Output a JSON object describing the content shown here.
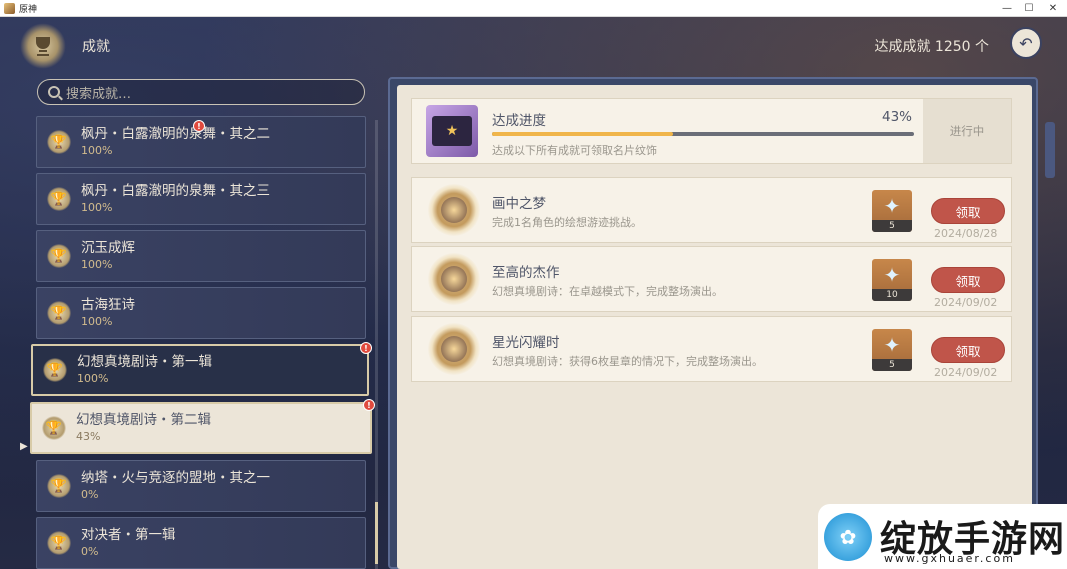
{
  "window": {
    "title": "原神",
    "minimize": "—",
    "maximize": "☐",
    "close": "✕"
  },
  "header": {
    "title": "成就",
    "achieved_label": "达成成就 1250 个",
    "back_icon": "↶"
  },
  "search": {
    "placeholder": "搜索成就…"
  },
  "categories": [
    {
      "name": "枫丹・白露澈明的泉舞・其之二",
      "percent": "100%",
      "badge": "!"
    },
    {
      "name": "枫丹・白露澈明的泉舞・其之三",
      "percent": "100%"
    },
    {
      "name": "沉玉成辉",
      "percent": "100%"
    },
    {
      "name": "古海狂诗",
      "percent": "100%"
    },
    {
      "name": "幻想真境剧诗・第一辑",
      "percent": "100%",
      "badge": "!"
    },
    {
      "name": "幻想真境剧诗・第二辑",
      "percent": "43%",
      "badge": "!"
    },
    {
      "name": "纳塔・火与竞逐的盟地・其之一",
      "percent": "0%"
    },
    {
      "name": "对决者・第一辑",
      "percent": "0%"
    }
  ],
  "progress": {
    "title": "达成进度",
    "percent_label": "43%",
    "percent_value": 0.43,
    "description": "达成以下所有成就可领取名片纹饰",
    "status": "进行中"
  },
  "achievements": [
    {
      "title": "画中之梦",
      "description": "完成1名角色的绘想游迹挑战。",
      "reward_count": "5",
      "button": "领取",
      "date": "2024/08/28"
    },
    {
      "title": "至高的杰作",
      "description": "幻想真境剧诗：在卓越模式下，完成整场演出。",
      "reward_count": "10",
      "button": "领取",
      "date": "2024/09/02"
    },
    {
      "title": "星光闪耀时",
      "description": "幻想真境剧诗：获得6枚星章的情况下，完成整场演出。",
      "reward_count": "5",
      "button": "领取",
      "date": "2024/09/02"
    }
  ],
  "watermark": {
    "text": "绽放手游网",
    "url": "www.gxhuaer.com"
  },
  "colors": {
    "accent": "#f0b54a",
    "claim": "#c0554a",
    "panel": "#ece5d8"
  }
}
